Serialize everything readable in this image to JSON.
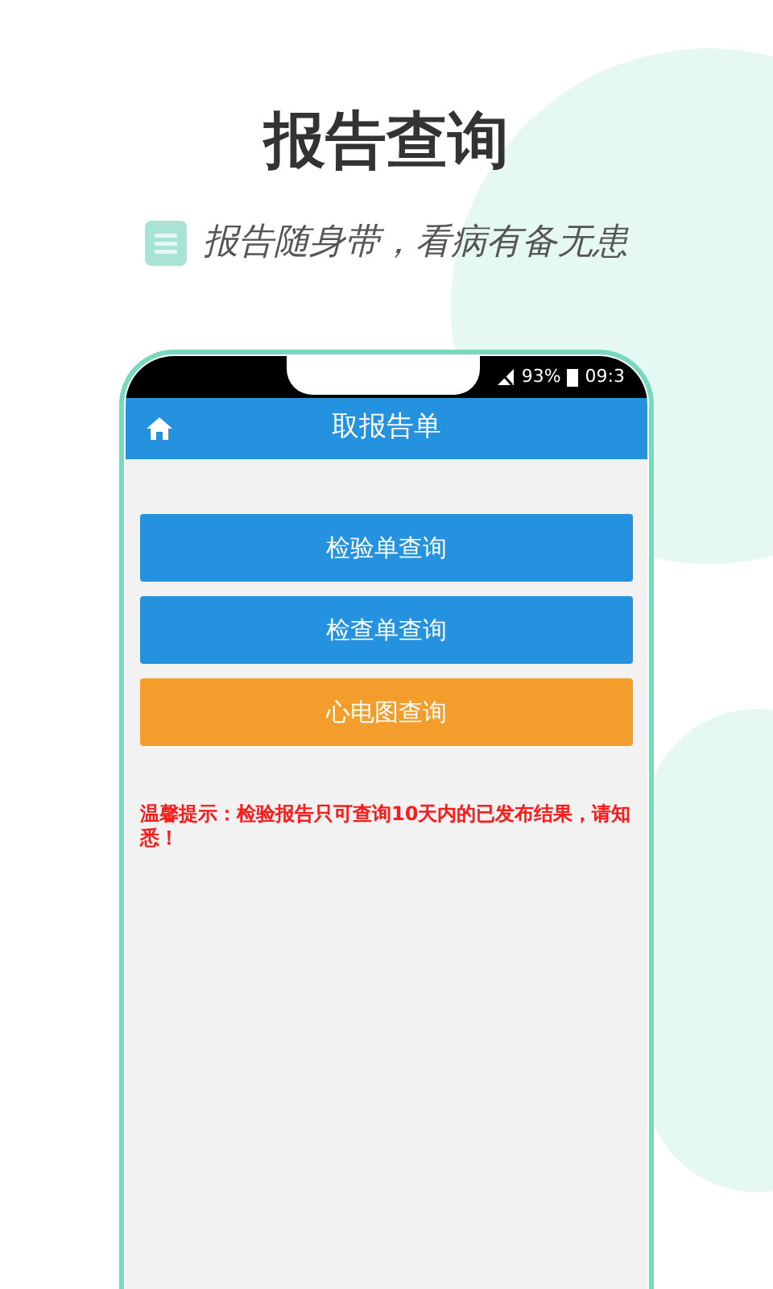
{
  "headline": "报告查询",
  "tagline": "报告随身带，看病有备无患",
  "status_bar": {
    "battery": "93%",
    "time": "09:3"
  },
  "nav": {
    "title": "取报告单"
  },
  "buttons": [
    {
      "label": "检验单查询",
      "kind": "primary"
    },
    {
      "label": "检查单查询",
      "kind": "primary"
    },
    {
      "label": "心电图查询",
      "kind": "warning"
    }
  ],
  "notice": "温馨提示：检验报告只可查询10天内的已发布结果，请知悉！"
}
